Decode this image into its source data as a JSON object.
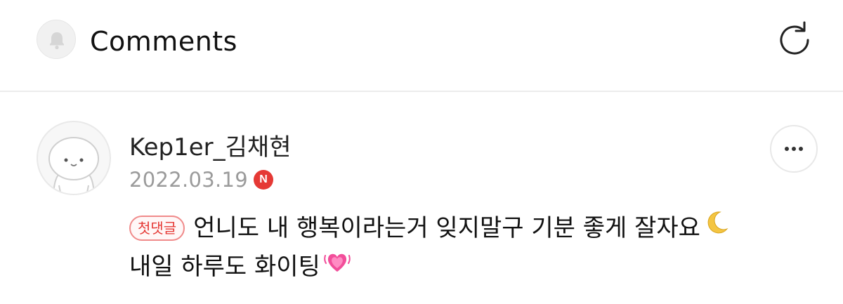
{
  "header": {
    "title": "Comments",
    "bell_icon": "bell-icon",
    "refresh_icon": "refresh-icon"
  },
  "comment": {
    "author": "Kep1er_김채현",
    "date": "2022.03.19",
    "new_badge": "N",
    "first_comment_badge": "첫댓글",
    "line1": "언니도 내 행복이라는거 잊지말구 기분 좋게 잘자요",
    "line2": "내일 하루도 화이팅",
    "emoji1": "crescent-moon-emoji",
    "emoji2": "sparkling-heart-emoji",
    "more_icon": "more-options-icon"
  },
  "colors": {
    "accent_red": "#e53935",
    "muted_text": "#9b9b9b",
    "divider": "#ececec"
  }
}
